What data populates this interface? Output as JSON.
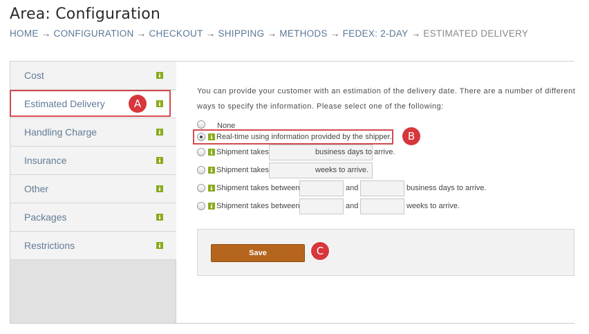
{
  "header": {
    "title": "Area: Configuration",
    "breadcrumb": [
      "HOME",
      "CONFIGURATION",
      "CHECKOUT",
      "SHIPPING",
      "METHODS",
      "FEDEX: 2-DAY",
      "ESTIMATED DELIVERY"
    ],
    "separator": "→"
  },
  "sidebar": {
    "items": [
      {
        "label": "Cost"
      },
      {
        "label": "Estimated Delivery",
        "active": true
      },
      {
        "label": "Handling Charge"
      },
      {
        "label": "Insurance"
      },
      {
        "label": "Other"
      },
      {
        "label": "Packages"
      },
      {
        "label": "Restrictions"
      }
    ]
  },
  "main": {
    "intro": "You can provide your customer with an estimation of the delivery date. There are a number of different ways to specify the information. Please select one of the following:",
    "options": {
      "none": {
        "label": "None"
      },
      "realtime": {
        "label": "Real-time using information provided by the shipper.",
        "selected": true
      },
      "days": {
        "prefix": "Shipment takes",
        "value": "",
        "suffix": "business days to arrive."
      },
      "weeks": {
        "prefix": "Shipment takes",
        "value": "",
        "suffix": "weeks to arrive."
      },
      "days_between": {
        "prefix": "Shipment takes between",
        "min": "",
        "and": "and",
        "max": "",
        "suffix": "business days to arrive."
      },
      "weeks_between": {
        "prefix": "Shipment takes between",
        "min": "",
        "and": "and",
        "max": "",
        "suffix": "weeks to arrive."
      }
    },
    "save_label": "Save"
  },
  "annotations": {
    "a": "A",
    "b": "B",
    "c": "C"
  },
  "colors": {
    "accent": "#b5651d",
    "marker": "#d7363c",
    "link": "#617b95",
    "info_icon": "#8aab1d"
  }
}
